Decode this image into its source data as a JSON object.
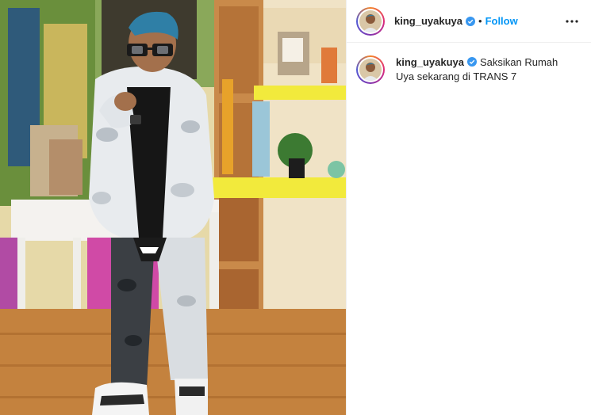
{
  "header": {
    "username": "king_uyakuya",
    "separator": "•",
    "follow_label": "Follow"
  },
  "caption": {
    "username": "king_uyakuya",
    "text": "Saksikan Rumah Uya sekarang di TRANS 7"
  },
  "icons": {
    "verified": "verified-badge-icon",
    "more": "more-options-icon",
    "avatar": "profile-avatar"
  },
  "colors": {
    "accent": "#0095f6",
    "verified": "#3897f0",
    "text": "#262626",
    "border": "#efefef"
  }
}
